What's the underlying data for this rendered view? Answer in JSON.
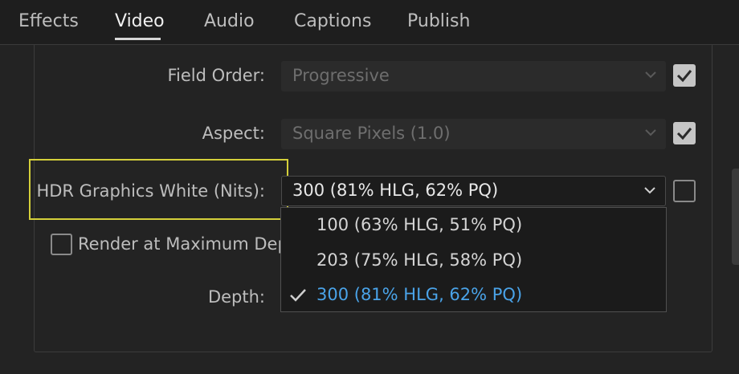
{
  "tabs": [
    {
      "label": "Effects"
    },
    {
      "label": "Video"
    },
    {
      "label": "Audio"
    },
    {
      "label": "Captions"
    },
    {
      "label": "Publish"
    }
  ],
  "active_tab": "Video",
  "field_order": {
    "label": "Field Order:",
    "value": "Progressive",
    "checked": true
  },
  "aspect": {
    "label": "Aspect:",
    "value": "Square Pixels (1.0)",
    "checked": true
  },
  "hdr_white": {
    "label": "HDR Graphics White (Nits):",
    "value": "300 (81% HLG, 62% PQ)",
    "checked": false,
    "options": [
      {
        "label": "100 (63% HLG, 51% PQ)",
        "selected": false
      },
      {
        "label": "203 (75% HLG, 58% PQ)",
        "selected": false
      },
      {
        "label": "300 (81% HLG, 62% PQ)",
        "selected": true
      }
    ]
  },
  "render_max_depth": {
    "label": "Render at Maximum Dept",
    "checked": false
  },
  "depth": {
    "label": "Depth:"
  },
  "colors": {
    "accent_selected": "#4aa3e8",
    "highlight_box": "#d4cf3a"
  }
}
